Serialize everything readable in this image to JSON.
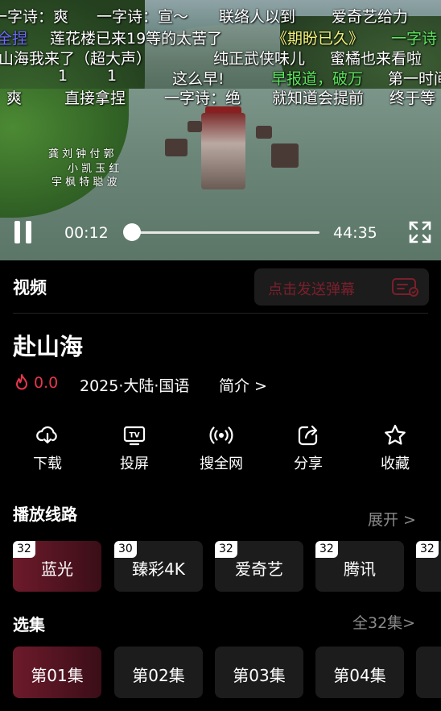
{
  "danmaku": [
    {
      "text": "一字诗：爽",
      "color": "#ffffff"
    },
    {
      "text": "一字诗：宣～",
      "color": "#ffffff"
    },
    {
      "text": "联络人以到",
      "color": "#ffffff"
    },
    {
      "text": "爱奇艺给力",
      "color": "#ffffff"
    },
    {
      "text": "全捏",
      "color": "#6f6cff"
    },
    {
      "text": "莲花楼已来19等的太苦了",
      "color": "#ffffff"
    },
    {
      "text": "《期盼已久》",
      "color": "#f2f27a"
    },
    {
      "text": "一字诗",
      "color": "#5ee65e"
    },
    {
      "text": "山海我来了（超大声）",
      "color": "#ffffff"
    },
    {
      "text": "纯正武侠味儿",
      "color": "#ffffff"
    },
    {
      "text": "蜜橘也来看啦",
      "color": "#ffffff"
    },
    {
      "text": "1",
      "color": "#ffffff"
    },
    {
      "text": "1",
      "color": "#ffffff"
    },
    {
      "text": "这么早!",
      "color": "#ffffff"
    },
    {
      "text": "早报道，破万",
      "color": "#5ee65e"
    },
    {
      "text": "第一时间",
      "color": "#ffffff"
    },
    {
      "text": "爽",
      "color": "#ffffff"
    },
    {
      "text": "直接拿捏",
      "color": "#ffffff"
    },
    {
      "text": "一字诗：绝",
      "color": "#ffffff"
    },
    {
      "text": "就知道会提前",
      "color": "#ffffff"
    },
    {
      "text": "终于等",
      "color": "#ffffff"
    }
  ],
  "credits": [
    "龚 刘 钟 付 郭",
    "小 凯 玉 红",
    "宇 枫 特 聪 波"
  ],
  "player": {
    "current_time": "00:12",
    "total_time": "44:35",
    "progress": 0.005
  },
  "header": {
    "section_label": "视频",
    "danmaku_placeholder": "点击发送弹幕"
  },
  "show": {
    "title": "赴山海",
    "heat": "0.0",
    "info": "2025·大陆·国语",
    "intro_link": "简介 >"
  },
  "actions": [
    {
      "label": "下载",
      "icon": "download-cloud-icon"
    },
    {
      "label": "投屏",
      "icon": "tv-cast-icon"
    },
    {
      "label": "搜全网",
      "icon": "broadcast-icon"
    },
    {
      "label": "分享",
      "icon": "share-icon"
    },
    {
      "label": "收藏",
      "icon": "star-icon"
    }
  ],
  "sources": {
    "title": "播放线路",
    "expand": "展开 >",
    "items": [
      {
        "label": "蓝光",
        "count": "32",
        "active": true
      },
      {
        "label": "臻彩4K",
        "count": "30",
        "active": false
      },
      {
        "label": "爱奇艺",
        "count": "32",
        "active": false
      },
      {
        "label": "腾讯",
        "count": "32",
        "active": false
      },
      {
        "label": "",
        "count": "32",
        "active": false
      }
    ]
  },
  "episodes": {
    "title": "选集",
    "all": "全32集>",
    "items": [
      {
        "label": "第01集",
        "active": true
      },
      {
        "label": "第02集",
        "active": false
      },
      {
        "label": "第03集",
        "active": false
      },
      {
        "label": "第04集",
        "active": false
      }
    ]
  },
  "colors": {
    "accent": "#7b1f2c",
    "heat": "#e8364d",
    "card": "#1c1c1c"
  }
}
